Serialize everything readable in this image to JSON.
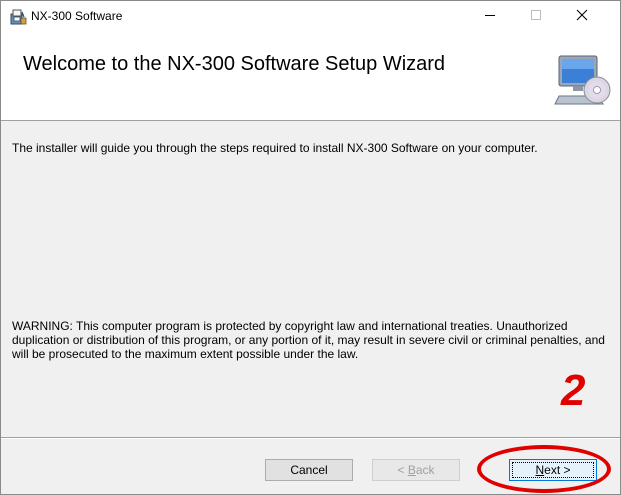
{
  "window": {
    "title": "NX-300 Software",
    "icons": {
      "app": "installer-package-icon",
      "minimize": "minimize-icon",
      "maximize": "maximize-icon",
      "close": "close-icon"
    }
  },
  "header": {
    "title": "Welcome to the NX-300 Software Setup Wizard",
    "graphic": "computer-cd-icon"
  },
  "body": {
    "intro": "The installer will guide you through the steps required to install NX-300 Software on your computer.",
    "warning": "WARNING: This computer program is protected by copyright law and international treaties. Unauthorized duplication or distribution of this program, or any portion of it, may result in severe civil or criminal penalties, and will be prosecuted to the maximum extent possible under the law."
  },
  "annotation": {
    "step_number": "2",
    "color": "#e00000"
  },
  "buttons": {
    "cancel": "Cancel",
    "back_prefix": "< ",
    "back_accel": "B",
    "back_rest": "ack",
    "next_accel": "N",
    "next_rest": "ext >"
  },
  "colors": {
    "window_bg": "#f0f0f0",
    "header_bg": "#ffffff",
    "focus_border": "#0078d7"
  }
}
